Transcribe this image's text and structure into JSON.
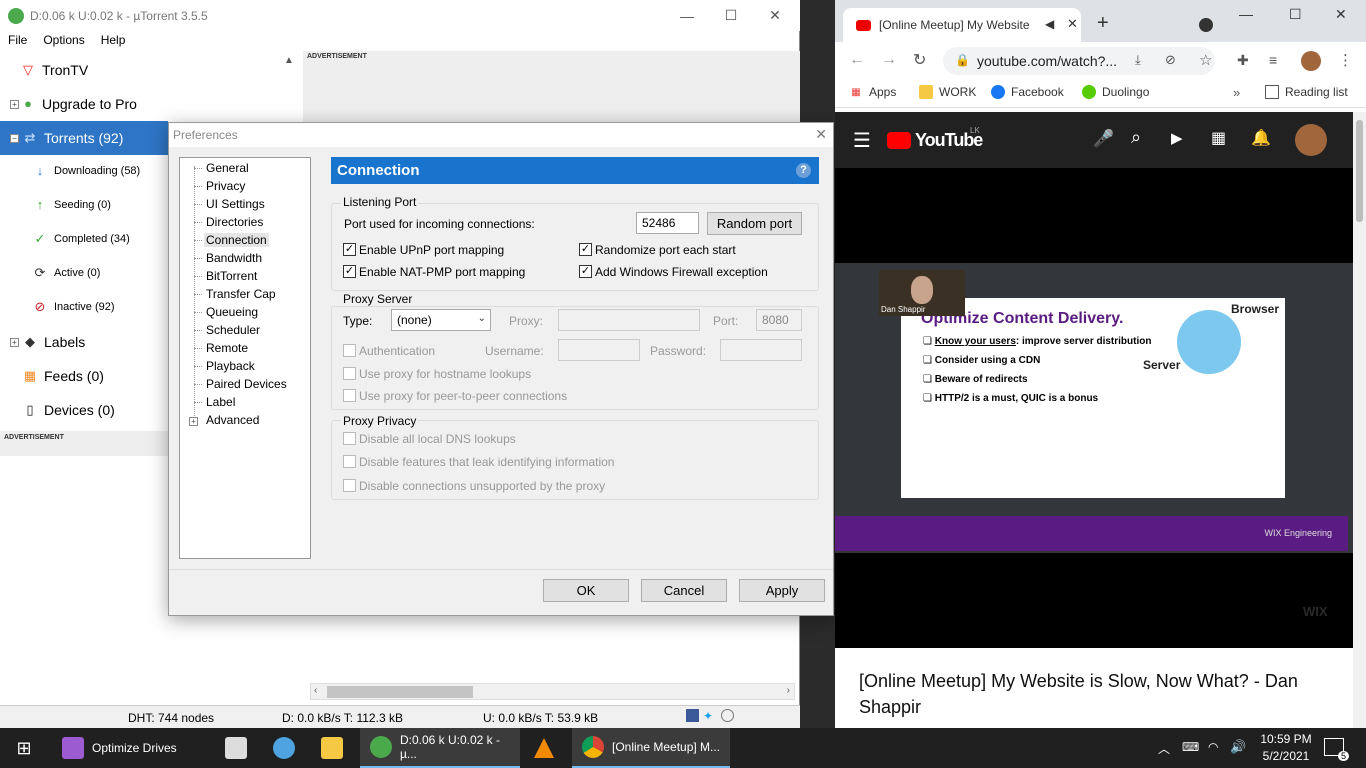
{
  "utorrent": {
    "title": "D:0.06 k U:0.02 k - µTorrent 3.5.5",
    "menu": [
      "File",
      "Options",
      "Help"
    ],
    "sidebar": [
      {
        "label": "TronTV"
      },
      {
        "label": "Upgrade to Pro"
      },
      {
        "label": "Torrents (92)"
      },
      {
        "label": "Downloading (58)"
      },
      {
        "label": "Seeding (0)"
      },
      {
        "label": "Completed (34)"
      },
      {
        "label": "Active (0)"
      },
      {
        "label": "Inactive (92)"
      },
      {
        "label": "Labels"
      },
      {
        "label": "Feeds (0)"
      },
      {
        "label": "Devices (0)"
      }
    ],
    "ad_label": "ADVERTISEMENT",
    "status": {
      "dht": "DHT: 744 nodes",
      "down": "D: 0.0 kB/s T: 112.3 kB",
      "up": "U: 0.0 kB/s T: 53.9 kB"
    }
  },
  "preferences": {
    "title": "Preferences",
    "tree": [
      "General",
      "Privacy",
      "UI Settings",
      "Directories",
      "Connection",
      "Bandwidth",
      "BitTorrent",
      "Transfer Cap",
      "Queueing",
      "Scheduler",
      "Remote",
      "Playback",
      "Paired Devices",
      "Label",
      "Advanced"
    ],
    "selected": "Connection",
    "header": "Connection",
    "help": "?",
    "listening": {
      "title": "Listening Port",
      "port_label": "Port used for incoming connections:",
      "port_value": "52486",
      "random_button": "Random port",
      "upnp": "Enable UPnP port mapping",
      "natpmp": "Enable NAT-PMP port mapping",
      "randomize": "Randomize port each start",
      "firewall": "Add Windows Firewall exception",
      "check": "✓"
    },
    "proxy": {
      "title": "Proxy Server",
      "type_label": "Type:",
      "type_value": "(none)",
      "proxy_label": "Proxy:",
      "port_label": "Port:",
      "port_value": "8080",
      "auth": "Authentication",
      "username": "Username:",
      "password": "Password:",
      "hostname": "Use proxy for hostname lookups",
      "p2p": "Use proxy for peer-to-peer connections"
    },
    "privacy": {
      "title": "Proxy Privacy",
      "dns": "Disable all local DNS lookups",
      "leak": "Disable features that leak identifying information",
      "unsupported": "Disable connections unsupported by the proxy"
    },
    "buttons": {
      "ok": "OK",
      "cancel": "Cancel",
      "apply": "Apply"
    }
  },
  "chrome": {
    "tab_title": "[Online Meetup] My Website",
    "url": "youtube.com/watch?...",
    "bookmarks": [
      "Apps",
      "WORK",
      "Facebook",
      "Duolingo"
    ],
    "reading_list": "Reading list",
    "yt_logo": "YouTube",
    "yt_region": "LK",
    "video": {
      "presenter": "Dan Shappir",
      "slide_title": "Optimize Content Delivery.",
      "bullet_1_link": "Know your users",
      "bullet_1_rest": ": improve server distribution",
      "bullets": [
        "Consider using a CDN",
        "Beware of redirects",
        "HTTP/2 is a must, QUIC is a bonus"
      ],
      "browser": "Browser",
      "server": "Server",
      "brand": "WIX Engineering",
      "watermark": "WIX"
    },
    "video_title": "[Online Meetup] My Website is Slow, Now What? - Dan Shappir"
  },
  "taskbar": {
    "items": [
      "Optimize Drives",
      "D:0.06 k U:0.02 k - µ...",
      "[Online Meetup] M..."
    ],
    "time": "10:59 PM",
    "date": "5/2/2021",
    "notifications": "5"
  },
  "colors": {
    "accent": "#1874cd",
    "selection": "#2e75c5",
    "yt_red": "#ff0000",
    "purple": "#5a1c82"
  }
}
